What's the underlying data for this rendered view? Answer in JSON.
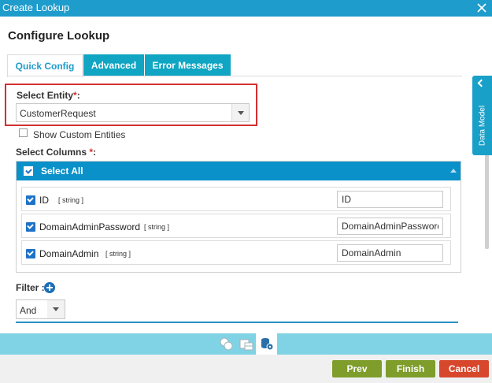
{
  "window": {
    "title": "Create Lookup"
  },
  "page": {
    "title": "Configure Lookup"
  },
  "tabs": [
    {
      "label": "Quick Config",
      "active": true
    },
    {
      "label": "Advanced",
      "active": false
    },
    {
      "label": "Error Messages",
      "active": false
    }
  ],
  "entity": {
    "label": "Select Entity",
    "required_mark": "*",
    "suffix": ":",
    "value": "CustomerRequest"
  },
  "show_custom": {
    "label": "Show Custom Entities",
    "checked": false
  },
  "columns": {
    "label": "Select Columns ",
    "required_mark": "*",
    "suffix": ":",
    "select_all_label": "Select All",
    "rows": [
      {
        "name": "ID",
        "type": "[ string ]",
        "alias": "ID",
        "checked": true
      },
      {
        "name": "DomainAdminPassword",
        "type": "[ string ]",
        "alias": "DomainAdminPassword",
        "checked": true
      },
      {
        "name": "DomainAdmin",
        "type": "[ string ]",
        "alias": "DomainAdmin",
        "checked": true
      }
    ]
  },
  "filter": {
    "label": "Filter :",
    "operator": "And"
  },
  "side_panel": {
    "label": "Data Model"
  },
  "footer": {
    "prev": "Prev",
    "finish": "Finish",
    "cancel": "Cancel"
  },
  "colors": {
    "primary": "#1e9ccc",
    "tab": "#0fa5c3",
    "select_all": "#0b91c9",
    "green": "#7e9d2a",
    "red": "#d7472c",
    "highlight": "#d32f2f"
  }
}
